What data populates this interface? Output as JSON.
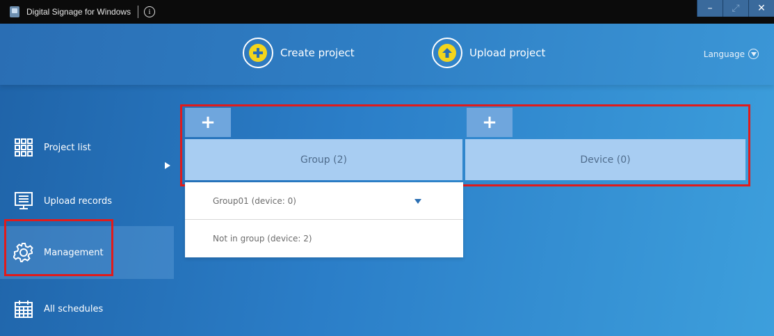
{
  "window": {
    "title": "Digital Signage for Windows",
    "info_symbol": "i",
    "minimize": "–",
    "maximize": "⤢",
    "close": "✕"
  },
  "toolbar": {
    "create_label": "Create project",
    "upload_label": "Upload project",
    "language_label": "Language",
    "accent_color": "#f3d51c"
  },
  "sidebar": {
    "items": [
      {
        "label": "Project list",
        "icon": "grid-icon"
      },
      {
        "label": "Upload records",
        "icon": "monitor-list-icon"
      },
      {
        "label": "Management",
        "icon": "gear-icon",
        "active": true
      },
      {
        "label": "All schedules",
        "icon": "calendar-icon"
      }
    ]
  },
  "management": {
    "add_symbol": "+",
    "group_tab": "Group (2)",
    "device_tab": "Device (0)",
    "groups": [
      {
        "label": "Group01 (device: 0)",
        "expandable": true
      },
      {
        "label": "Not in group (device: 2)",
        "expandable": false
      }
    ]
  },
  "colors": {
    "highlight": "#e11b1b",
    "tab_bg": "#a8cdf2",
    "add_bg": "#6fa6dd"
  }
}
